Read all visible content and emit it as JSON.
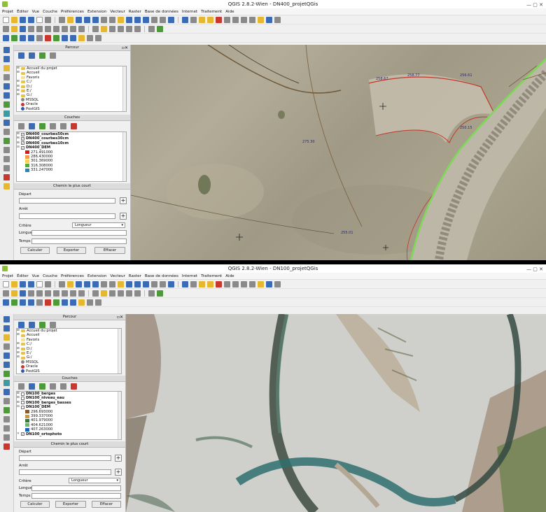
{
  "windows": [
    {
      "title": "QGIS 2.8.2-Wien - DN400_projetQGis",
      "menu": [
        "Projet",
        "Éditer",
        "Vue",
        "Couche",
        "Préférences",
        "Extension",
        "Vecteur",
        "Raster",
        "Base de données",
        "Internet",
        "Traitement",
        "Aide"
      ],
      "browser": {
        "title": "Parcour",
        "items": [
          {
            "label": "Accueil du projet",
            "icon": "folder-icon"
          },
          {
            "label": "Accueil",
            "icon": "folder-icon"
          },
          {
            "label": "Favoris",
            "icon": "star-icon"
          },
          {
            "label": "C:/",
            "icon": "folder-icon"
          },
          {
            "label": "D:/",
            "icon": "folder-icon"
          },
          {
            "label": "E:/",
            "icon": "folder-icon"
          },
          {
            "label": "G:/",
            "icon": "folder-icon"
          },
          {
            "label": "MSSQL",
            "icon": "database-icon"
          },
          {
            "label": "Oracle",
            "icon": "database-icon"
          },
          {
            "label": "PostGIS",
            "icon": "database-icon"
          }
        ]
      },
      "layers": {
        "title": "Couches",
        "items": [
          {
            "label": "DN400_courbes50cm",
            "checked": true,
            "bold": true
          },
          {
            "label": "DN400_courbes30cm",
            "checked": true,
            "bold": true
          },
          {
            "label": "DN400_courbes10cm",
            "checked": true,
            "bold": true
          },
          {
            "label": "DN400_DEM",
            "checked": true,
            "bold": true
          }
        ],
        "legend": [
          {
            "label": "271.491000",
            "color": "#d7191c"
          },
          {
            "label": "286.430000",
            "color": "#f39a4b"
          },
          {
            "label": "301.369000",
            "color": "#f7d254"
          },
          {
            "label": "316.308000",
            "color": "#56a845"
          },
          {
            "label": "331.247000",
            "color": "#2b83ba"
          }
        ]
      },
      "shortest_path": {
        "title": "Chemin le plus court",
        "depart_label": "Départ",
        "arret_label": "Arrêt",
        "critere_label": "Critère",
        "critere_value": "Longueur",
        "longueur_label": "Longueur",
        "temps_label": "Temps",
        "calculer": "Calculer",
        "exporter": "Exporter",
        "effacer": "Effacer"
      }
    },
    {
      "title": "QGIS 2.8.2-Wien - DN100_projetQGis",
      "menu": [
        "Projet",
        "Éditer",
        "Vue",
        "Couche",
        "Préférences",
        "Extension",
        "Vecteur",
        "Raster",
        "Base de données",
        "Internet",
        "Traitement",
        "Aide"
      ],
      "browser": {
        "title": "Parcour",
        "items": [
          {
            "label": "Accueil du projet",
            "icon": "folder-icon"
          },
          {
            "label": "Accueil",
            "icon": "folder-icon"
          },
          {
            "label": "Favoris",
            "icon": "star-icon"
          },
          {
            "label": "C:/",
            "icon": "folder-icon"
          },
          {
            "label": "D:/",
            "icon": "folder-icon"
          },
          {
            "label": "E:/",
            "icon": "folder-icon"
          },
          {
            "label": "G:/",
            "icon": "folder-icon"
          },
          {
            "label": "MSSQL",
            "icon": "database-icon"
          },
          {
            "label": "Oracle",
            "icon": "database-icon"
          },
          {
            "label": "PostGIS",
            "icon": "database-icon"
          }
        ]
      },
      "layers": {
        "title": "Couches",
        "items": [
          {
            "label": "DN100_berges",
            "checked": false,
            "bold": true
          },
          {
            "label": "DN100_niveau_eau",
            "checked": false,
            "bold": true
          },
          {
            "label": "DN100_berges_basses",
            "checked": false,
            "bold": true
          },
          {
            "label": "DN100_DEM",
            "checked": false,
            "bold": true
          }
        ],
        "legend": [
          {
            "label": "296.693000",
            "color": "#8a5a2b"
          },
          {
            "label": "399.337000",
            "color": "#c89b3c"
          },
          {
            "label": "401.979000",
            "color": "#2e7d32"
          },
          {
            "label": "404.621000",
            "color": "#66bb6a"
          },
          {
            "label": "407.263000",
            "color": "#1565c0"
          }
        ],
        "extra": {
          "label": "DN100_ortophoto",
          "checked": true,
          "bold": true
        }
      },
      "shortest_path": {
        "title": "Chemin le plus court",
        "depart_label": "Départ",
        "arret_label": "Arrêt",
        "critere_label": "Critère",
        "critere_value": "Longueur",
        "longueur_label": "Longueur",
        "temps_label": "Temps",
        "calculer": "Calculer",
        "exporter": "Exporter",
        "effacer": "Effacer"
      }
    }
  ],
  "map1_labels": [
    "258.67",
    "258.77",
    "256.61",
    "275.30",
    "255.01",
    "250.15"
  ],
  "colors": {
    "accent": "#3b6bb5",
    "contour_red": "#c0392b",
    "bank_green": "#7ed957",
    "river_blue": "#2f6e6e"
  }
}
